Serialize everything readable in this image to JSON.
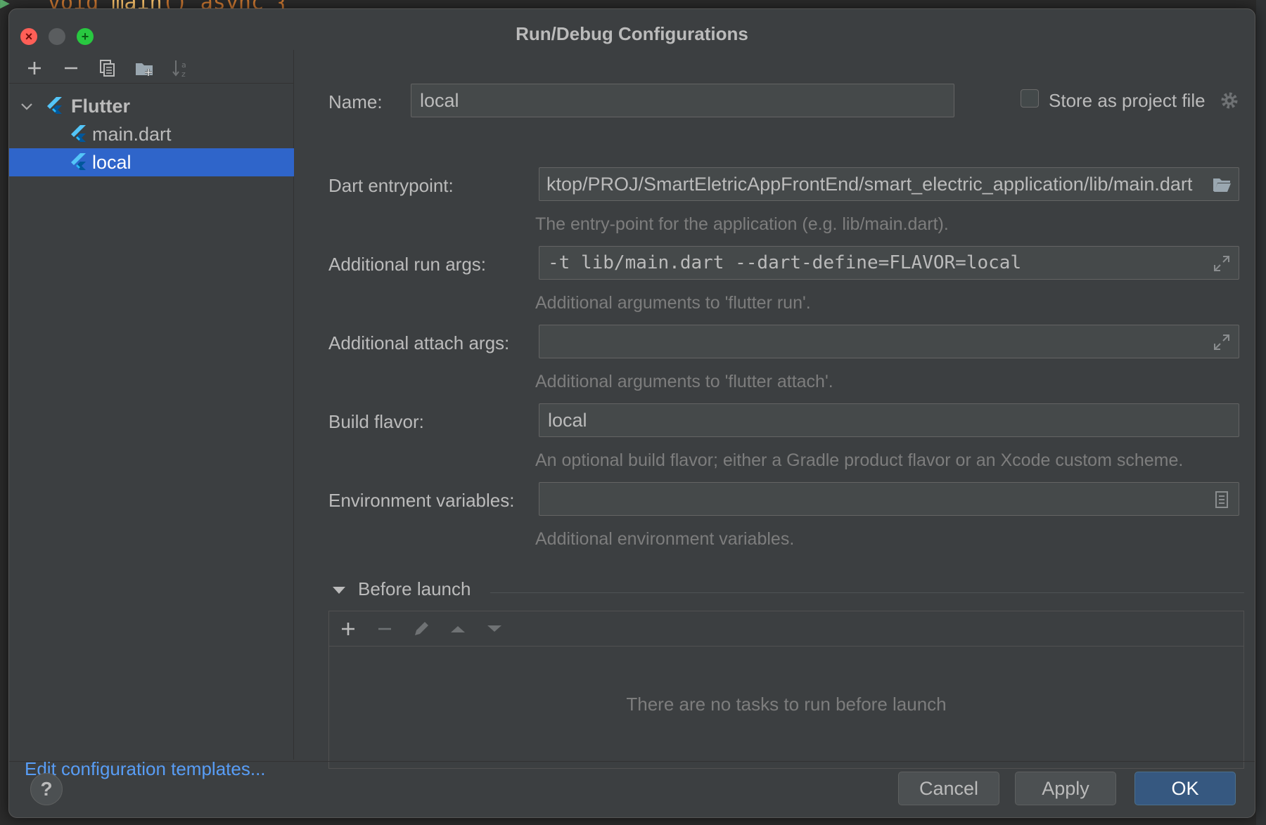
{
  "background": {
    "code_keyword": "void",
    "code_fn": "main",
    "code_rest": "() async {"
  },
  "dialog": {
    "title": "Run/Debug Configurations",
    "window_buttons": {
      "close": "×",
      "zoom": "+"
    }
  },
  "left_toolbar": {
    "icons": [
      "add-icon",
      "remove-icon",
      "copy-icon",
      "new-folder-icon",
      "sort-icon"
    ]
  },
  "tree": {
    "group": {
      "label": "Flutter",
      "expanded": true
    },
    "items": [
      {
        "label": "main.dart",
        "selected": false
      },
      {
        "label": "local",
        "selected": true
      }
    ]
  },
  "edit_templates_link": "Edit configuration templates...",
  "form": {
    "name_label": "Name:",
    "name_value": "local",
    "store_label": "Store as project file",
    "store_checked": false,
    "dart_entry_label": "Dart entrypoint:",
    "dart_entry_value": "ktop/PROJ/SmartEletricAppFrontEnd/smart_electric_application/lib/main.dart",
    "dart_entry_hint": "The entry-point for the application (e.g. lib/main.dart).",
    "run_args_label": "Additional run args:",
    "run_args_value": "-t lib/main.dart --dart-define=FLAVOR=local",
    "run_args_hint": "Additional arguments to 'flutter run'.",
    "attach_args_label": "Additional attach args:",
    "attach_args_value": "",
    "attach_args_hint": "Additional arguments to 'flutter attach'.",
    "flavor_label": "Build flavor:",
    "flavor_value": "local",
    "flavor_hint": "An optional build flavor; either a Gradle product flavor or an Xcode custom scheme.",
    "env_label": "Environment variables:",
    "env_value": "",
    "env_hint": "Additional environment variables."
  },
  "before_launch": {
    "header": "Before launch",
    "empty_text": "There are no tasks to run before launch",
    "toolbar_icons": [
      "add-icon",
      "remove-icon",
      "edit-icon",
      "move-up-icon",
      "move-down-icon"
    ]
  },
  "footer": {
    "help_label": "?",
    "cancel_label": "Cancel",
    "apply_label": "Apply",
    "ok_label": "OK"
  },
  "colors": {
    "dialog_bg": "#3c3f41",
    "selection": "#2f65ca",
    "link": "#589df6",
    "primary_button": "#365880"
  }
}
